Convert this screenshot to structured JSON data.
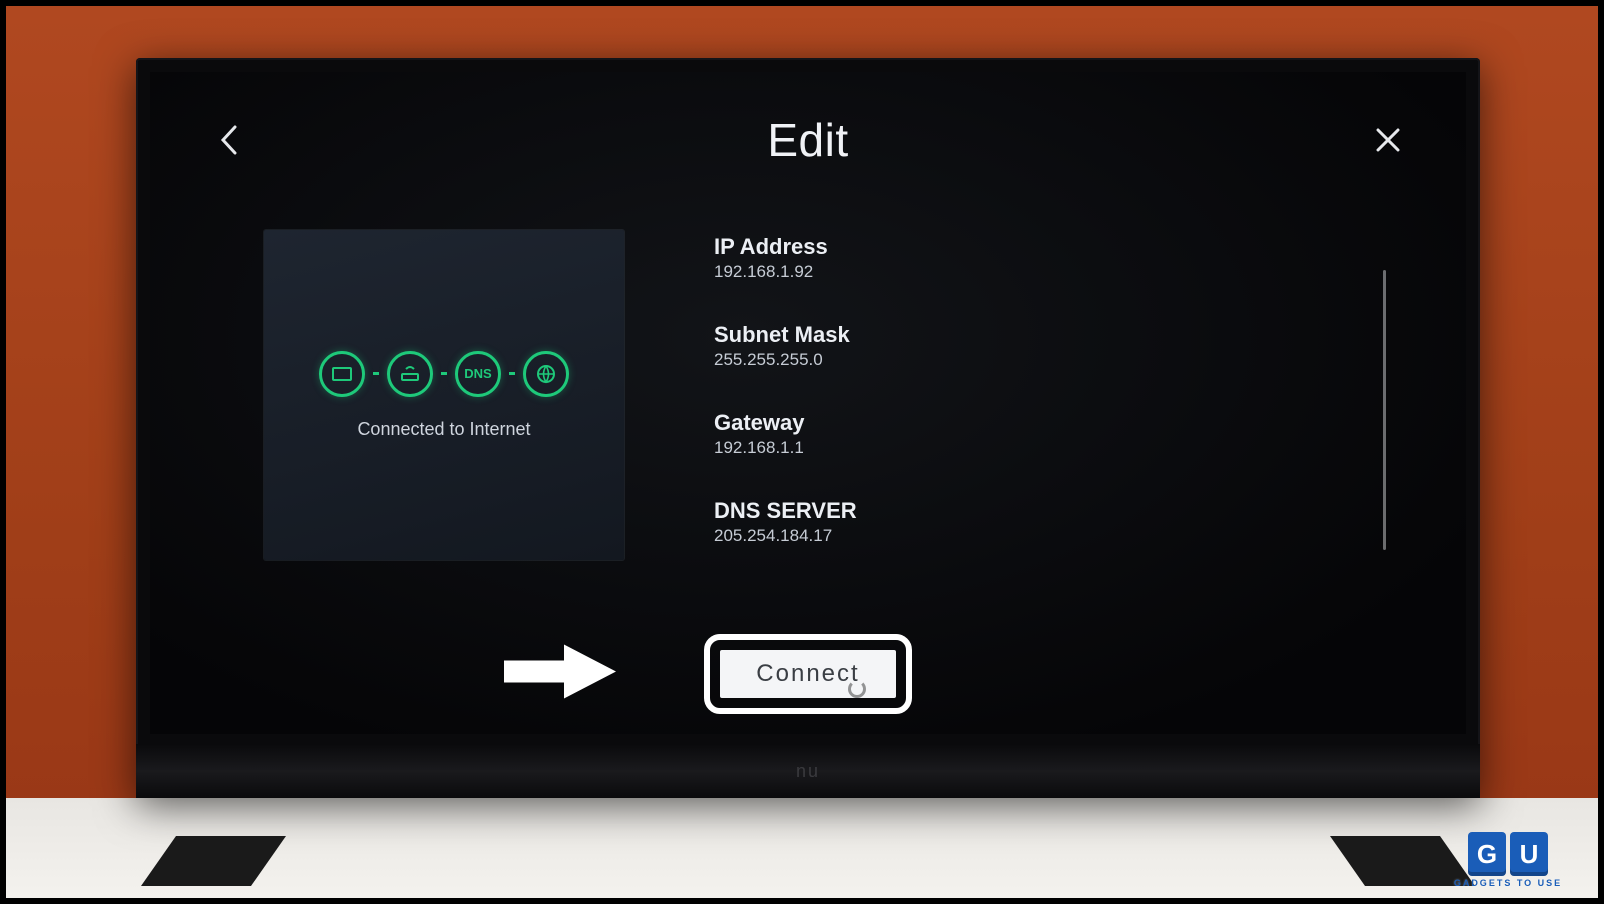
{
  "header": {
    "title": "Edit"
  },
  "status_card": {
    "dns_label": "DNS",
    "status": "Connected to Internet"
  },
  "fields": {
    "ip": {
      "label": "IP Address",
      "value": "192.168.1.92"
    },
    "subnet": {
      "label": "Subnet Mask",
      "value": "255.255.255.0"
    },
    "gateway": {
      "label": "Gateway",
      "value": "192.168.1.1"
    },
    "dns": {
      "label": "DNS SERVER",
      "value": "205.254.184.17"
    }
  },
  "connect_button": "Connect",
  "tv_brand": "nu",
  "watermark": {
    "g": "G",
    "u": "U",
    "text": "GADGETS TO USE"
  }
}
